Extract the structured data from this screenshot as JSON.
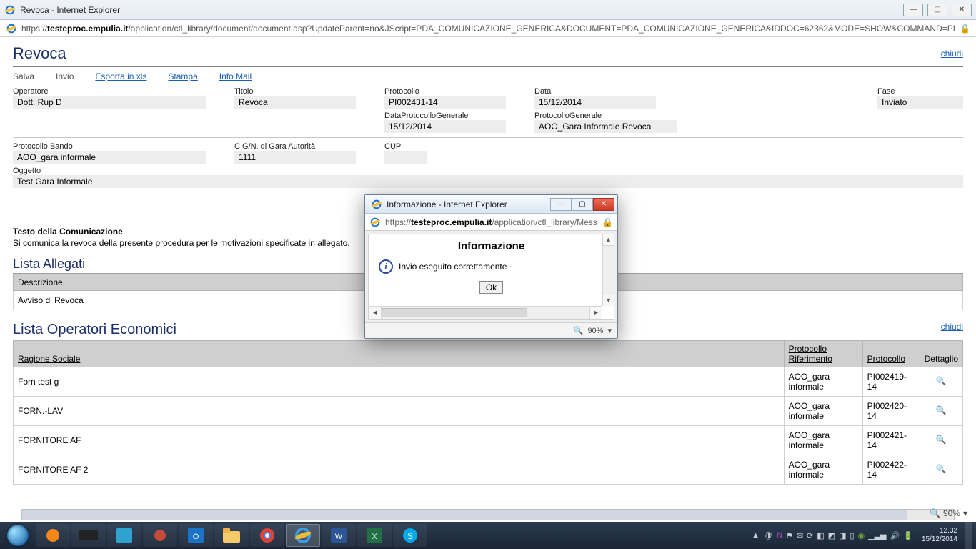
{
  "main_window": {
    "title": "Revoca - Internet Explorer",
    "url_prefix": "https://",
    "url_host": "testeproc.empulia.it",
    "url_path": "/application/ctl_library/document/document.asp?UpdateParent=no&JScript=PDA_COMUNICAZIONE_GENERICA&DOCUMENT=PDA_COMUNICAZIONE_GENERICA&IDDOC=62362&MODE=SHOW&COMMAND=PROCE",
    "zoom": "90%"
  },
  "page": {
    "title": "Revoca",
    "chiudi": "chiudi",
    "actions": {
      "salva": "Salva",
      "invio": "Invio",
      "esporta": "Esporta in xls",
      "stampa": "Stampa",
      "infomail": "Info Mail"
    },
    "fields": {
      "operatore_lbl": "Operatore",
      "operatore_val": "Dott. Rup D",
      "titolo_lbl": "Titolo",
      "titolo_val": "Revoca",
      "protocollo_lbl": "Protocollo",
      "protocollo_val": "PI002431-14",
      "data_lbl": "Data",
      "data_val": "15/12/2014",
      "fase_lbl": "Fase",
      "fase_val": "Inviato",
      "dpg_lbl": "DataProtocolloGenerale",
      "dpg_val": "15/12/2014",
      "pg_lbl": "ProtocolloGenerale",
      "pg_val": "AOO_Gara Informale Revoca",
      "pbando_lbl": "Protocollo Bando",
      "pbando_val": "AOO_gara informale",
      "cig_lbl": "CIG/N. di Gara Autorità",
      "cig_val": "1111",
      "cup_lbl": "CUP",
      "cup_val": " ",
      "oggetto_lbl": "Oggetto",
      "oggetto_val": "Test Gara Informale"
    },
    "comm_lbl": "Testo della Comunicazione",
    "comm_txt": "Si comunica la revoca della presente procedura per le motivazioni specificate in allegato.",
    "allegati_title": "Lista Allegati",
    "allegati_hdr": "Descrizione",
    "allegati_row": "Avviso di Revoca",
    "operatori_title": "Lista Operatori Economici",
    "operatori_hdr": {
      "rs": "Ragione Sociale",
      "pr": "Protocollo Riferimento",
      "p": "Protocollo",
      "d": "Dettaglio"
    },
    "operatori_rows": [
      {
        "rs": "Forn test g",
        "pr": "AOO_gara informale",
        "p": "PI002419-14"
      },
      {
        "rs": "FORN.-LAV",
        "pr": "AOO_gara informale",
        "p": "PI002420-14"
      },
      {
        "rs": "FORNITORE AF",
        "pr": "AOO_gara informale",
        "p": "PI002421-14"
      },
      {
        "rs": "FORNITORE AF 2",
        "pr": "AOO_gara informale",
        "p": "PI002422-14"
      }
    ]
  },
  "popup": {
    "title": "Informazione - Internet Explorer",
    "url_prefix": "https://",
    "url_host": "testeproc.empulia.it",
    "url_path": "/application/ctl_library/Mess",
    "heading": "Informazione",
    "message": "Invio eseguito correttamente",
    "ok": "Ok",
    "zoom": "90%"
  },
  "taskbar": {
    "time": "12.32",
    "date": "15/12/2014"
  }
}
